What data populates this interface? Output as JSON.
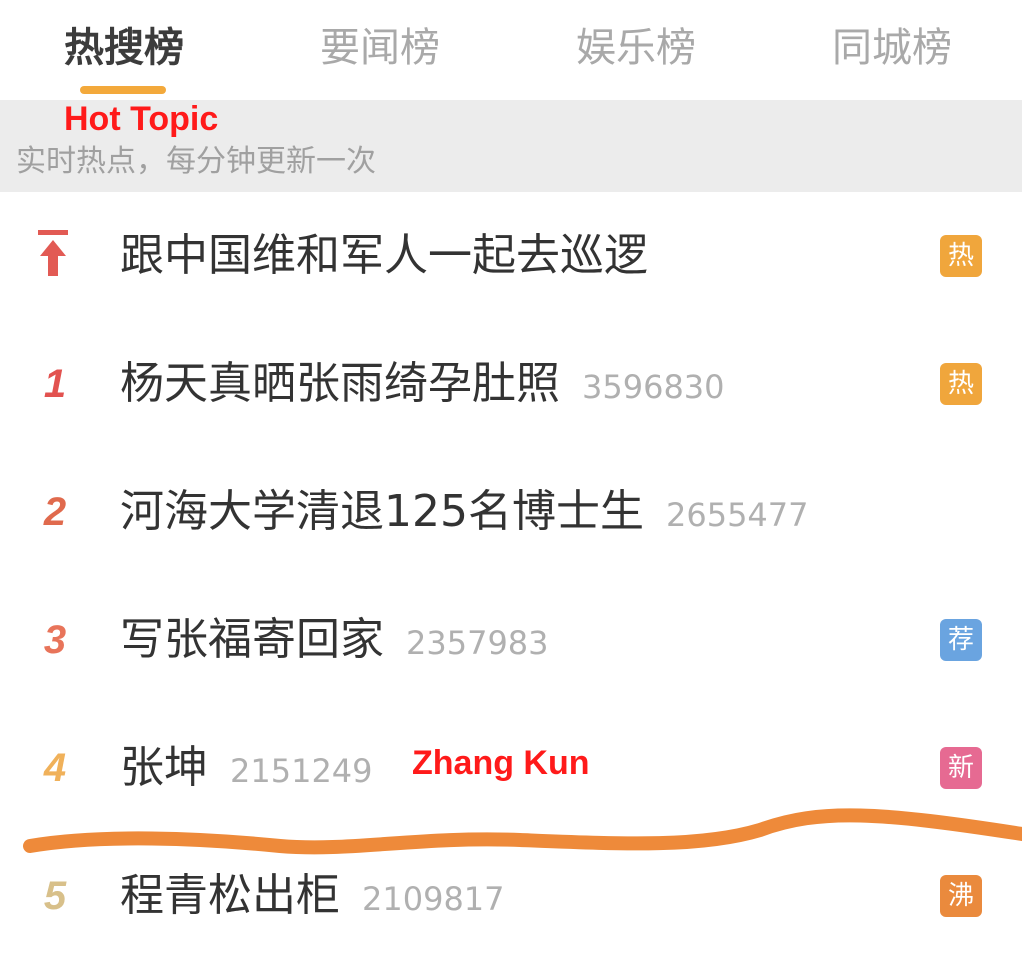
{
  "tabs": [
    {
      "label": "热搜榜",
      "active": true
    },
    {
      "label": "要闻榜",
      "active": false
    },
    {
      "label": "娱乐榜",
      "active": false
    },
    {
      "label": "同城榜",
      "active": false
    }
  ],
  "subheader": {
    "annotation": "Hot Topic",
    "text": "实时热点，每分钟更新一次"
  },
  "list": [
    {
      "rank": "",
      "rank_icon": "pin-top-icon",
      "title": "跟中国维和军人一起去巡逻",
      "count": "",
      "badge": "热",
      "badge_color": "#f0a63c"
    },
    {
      "rank": "1",
      "title": "杨天真晒张雨绮孕肚照",
      "count": "3596830",
      "badge": "热",
      "badge_color": "#f0a63c",
      "rank_color": "#e2524f"
    },
    {
      "rank": "2",
      "title": "河海大学清退125名博士生",
      "count": "2655477",
      "badge": "",
      "badge_color": "",
      "rank_color": "#e06a4d"
    },
    {
      "rank": "3",
      "title": "写张福寄回家",
      "count": "2357983",
      "badge": "荐",
      "badge_color": "#6aa4e0",
      "rank_color": "#e8745a"
    },
    {
      "rank": "4",
      "title": "张坤",
      "count": "2151249",
      "badge": "新",
      "badge_color": "#e66a92",
      "rank_color": "#f0b15a"
    },
    {
      "rank": "5",
      "title": "程青松出柜",
      "count": "2109817",
      "badge": "沸",
      "badge_color": "#ea8a3d",
      "rank_color": "#d8c08a"
    }
  ],
  "annotations": {
    "zhang_kun": "Zhang Kun"
  },
  "colors": {
    "tab_underline": "#f3a93b",
    "annotation_red": "#ff1a1a",
    "squiggle": "#ee8a3a"
  }
}
